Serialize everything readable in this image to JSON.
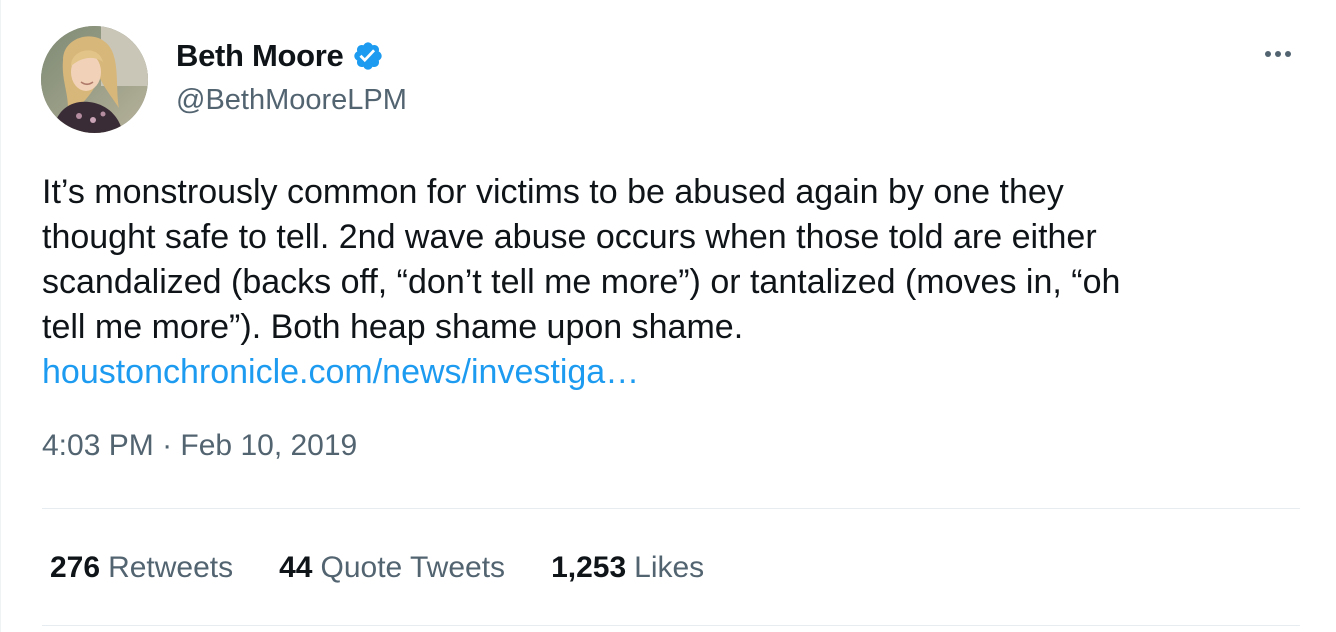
{
  "author": {
    "display_name": "Beth Moore",
    "handle": "@BethMooreLPM",
    "verified": true
  },
  "icons": {
    "verified": "verified-badge-icon",
    "more": "more-options-icon"
  },
  "tweet": {
    "lines": [
      "It’s monstrously common for victims to be abused again by one they",
      "thought safe to tell. 2nd wave abuse occurs when those told are either",
      "scandalized (backs off, “don’t tell me more”) or tantalized (moves in, “oh",
      "tell me more”). Both heap shame upon shame."
    ],
    "link": "houstonchronicle.com/news/investiga…",
    "time": "4:03 PM",
    "separator": "·",
    "date": "Feb 10, 2019"
  },
  "stats": {
    "retweets": {
      "count": "276",
      "label": "Retweets"
    },
    "quotes": {
      "count": "44",
      "label": "Quote Tweets"
    },
    "likes": {
      "count": "1,253",
      "label": "Likes"
    }
  },
  "colors": {
    "text_primary": "#0f1419",
    "text_secondary": "#536471",
    "link": "#1d9bf0",
    "verified": "#1d9bf0",
    "divider": "#e6ecf0"
  }
}
